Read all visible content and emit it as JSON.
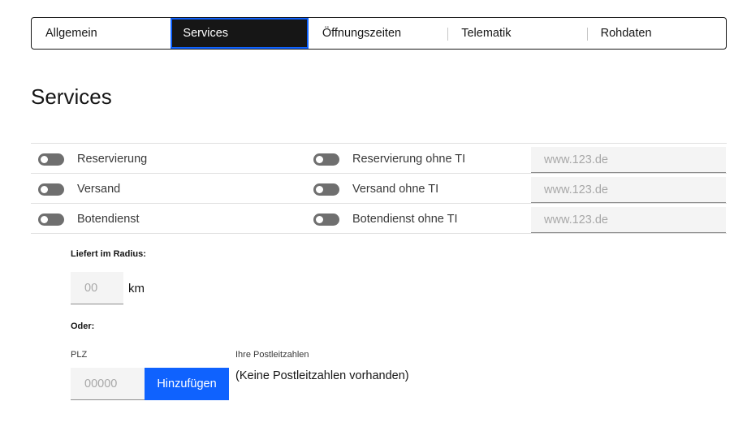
{
  "tabs": [
    {
      "label": "Allgemein",
      "active": false
    },
    {
      "label": "Services",
      "active": true
    },
    {
      "label": "Öffnungszeiten",
      "active": false
    },
    {
      "label": "Telematik",
      "active": false
    },
    {
      "label": "Rohdaten",
      "active": false
    }
  ],
  "page_title": "Services",
  "services": [
    {
      "label": "Reservierung",
      "label_ti": "Reservierung ohne TI",
      "url_placeholder": "www.123.de",
      "enabled": false,
      "enabled_ti": false
    },
    {
      "label": "Versand",
      "label_ti": "Versand ohne TI",
      "url_placeholder": "www.123.de",
      "enabled": false,
      "enabled_ti": false
    },
    {
      "label": "Botendienst",
      "label_ti": "Botendienst ohne TI",
      "url_placeholder": "www.123.de",
      "enabled": false,
      "enabled_ti": false
    }
  ],
  "delivery": {
    "radius_label": "Liefert im Radius:",
    "radius_placeholder": "00",
    "radius_unit": "km",
    "or_label": "Oder:",
    "plz_label": "PLZ",
    "plz_placeholder": "00000",
    "add_button": "Hinzufügen",
    "postcodes_label": "Ihre Postleitzahlen",
    "postcodes_empty": "(Keine Postleitzahlen vorhanden)"
  },
  "colors": {
    "accent": "#0f62fe",
    "active_tab": "#161616",
    "toggle_off": "#6f6f6f",
    "field_bg": "#f4f4f4"
  }
}
